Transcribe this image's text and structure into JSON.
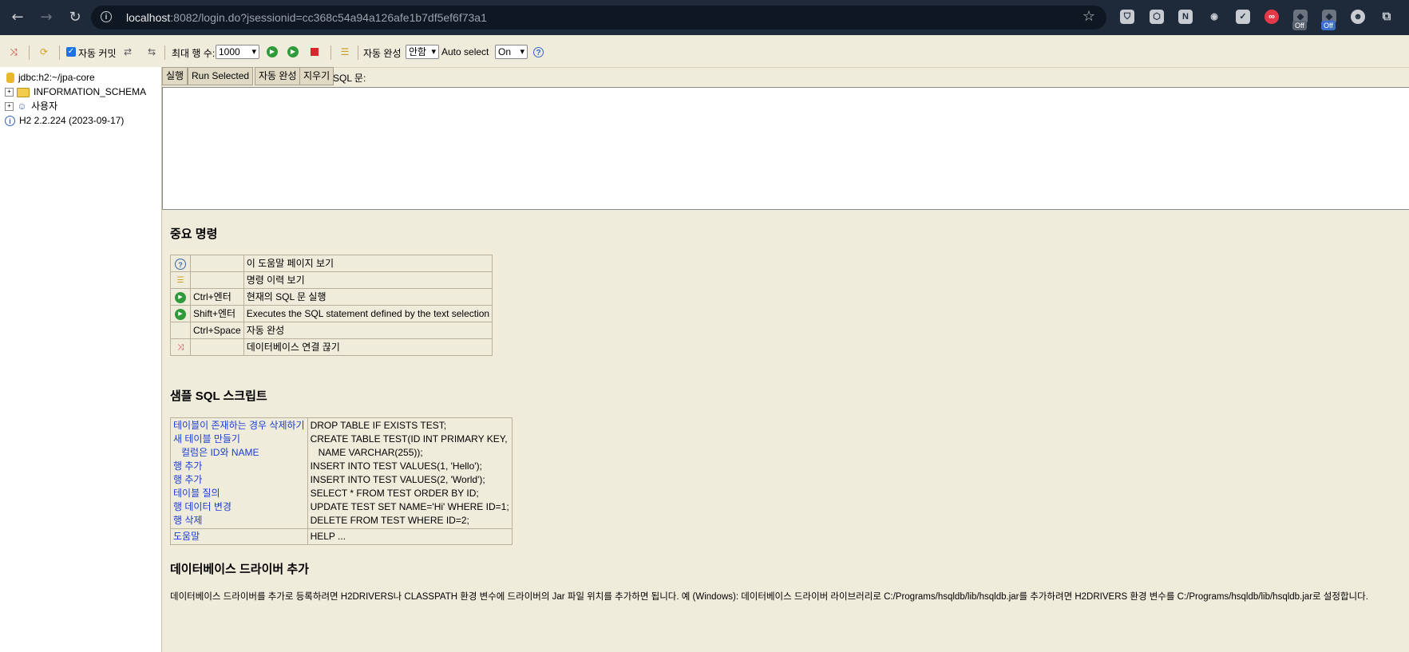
{
  "browser": {
    "url_host": "localhost",
    "url_rest": ":8082/login.do?jsessionid=cc368c54a94a126afe1b7df5ef6f73a1",
    "ext_badges": [
      "Off",
      "Off"
    ]
  },
  "toolbar": {
    "auto_commit_label": "자동 커밋",
    "max_rows_label": "최대 행 수:",
    "max_rows_value": "1000",
    "auto_complete_label": "자동 완성",
    "auto_complete_value": "안함",
    "auto_select_label": "Auto select",
    "auto_select_value": "On"
  },
  "tree": {
    "connection": "jdbc:h2:~/jpa-core",
    "schema": "INFORMATION_SCHEMA",
    "users": "사용자",
    "version": "H2 2.2.224 (2023-09-17)"
  },
  "query": {
    "run_label": "실행",
    "run_selected_label": "Run Selected",
    "auto_complete_label": "자동 완성",
    "clear_label": "지우기",
    "sql_label": "SQL 문:"
  },
  "help": {
    "important_title": "중요 명령",
    "commands": [
      {
        "icon": "help-icon",
        "key": "",
        "desc": "이 도움말 페이지 보기"
      },
      {
        "icon": "history-icon",
        "key": "",
        "desc": "명령 이력 보기"
      },
      {
        "icon": "run-icon",
        "key": "Ctrl+엔터",
        "desc": "현재의 SQL 문 실행"
      },
      {
        "icon": "run-selected-icon",
        "key": "Shift+엔터",
        "desc": "Executes the SQL statement defined by the text selection"
      },
      {
        "icon": "",
        "key": "Ctrl+Space",
        "desc": "자동 완성"
      },
      {
        "icon": "disconnect-icon",
        "key": "",
        "desc": "데이터베이스 연결 끊기"
      }
    ],
    "sample_title": "샘플 SQL 스크립트",
    "samples": [
      {
        "label": "테이블이 존재하는 경우 삭제하기",
        "sql": "DROP TABLE IF EXISTS TEST;"
      },
      {
        "label": "새 테이블 만들기",
        "sql": "CREATE TABLE TEST(ID INT PRIMARY KEY,"
      },
      {
        "label": "컬럼은 ID와 NAME",
        "sql": "NAME VARCHAR(255));"
      },
      {
        "label": "행 추가",
        "sql": "INSERT INTO TEST VALUES(1, 'Hello');"
      },
      {
        "label": "행 추가",
        "sql": "INSERT INTO TEST VALUES(2, 'World');"
      },
      {
        "label": "테이블 질의",
        "sql": "SELECT * FROM TEST ORDER BY ID;"
      },
      {
        "label": "행 데이터 변경",
        "sql": "UPDATE TEST SET NAME='Hi' WHERE ID=1;"
      },
      {
        "label": "행 삭제",
        "sql": "DELETE FROM TEST WHERE ID=2;"
      }
    ],
    "help_label": "도움말",
    "help_sql": "HELP ...",
    "driver_title": "데이터베이스 드라이버 추가",
    "driver_text": "데이터베이스 드라이버를 추가로 등록하려면 H2DRIVERS나 CLASSPATH 환경 변수에 드라이버의 Jar 파일 위치를 추가하면 됩니다. 예 (Windows): 데이터베이스 드라이버 라이브러리로 C:/Programs/hsqldb/lib/hsqldb.jar를 추가하려면 H2DRIVERS 환경 변수를 C:/Programs/hsqldb/lib/hsqldb.jar로 설정합니다."
  }
}
